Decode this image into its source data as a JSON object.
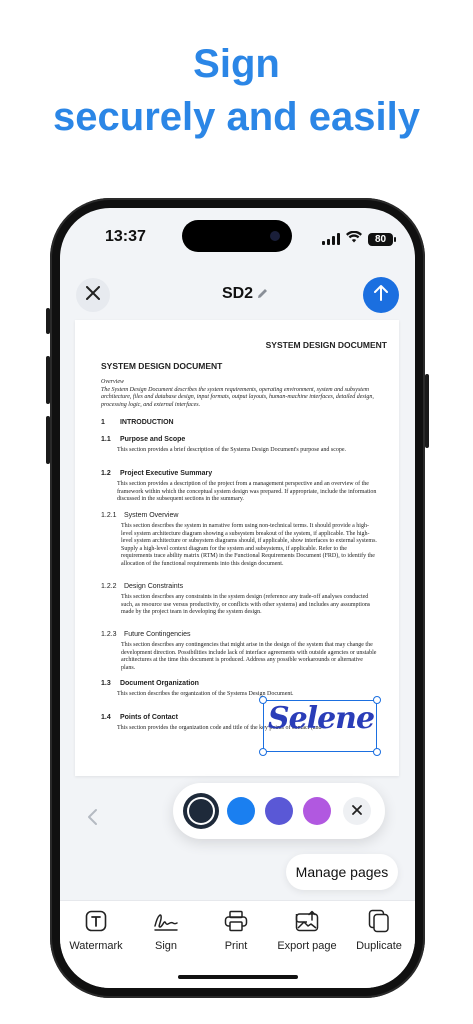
{
  "promo": {
    "line1": "Sign",
    "line2": "securely and easily"
  },
  "status_bar": {
    "time": "13:37",
    "battery": "80"
  },
  "header": {
    "title": "SD2",
    "close_icon": "close-icon",
    "edit_icon": "pencil-icon",
    "upload_icon": "arrow-up-icon"
  },
  "document": {
    "running_header": "SYSTEM DESIGN DOCUMENT",
    "main_title": "SYSTEM DESIGN DOCUMENT",
    "overview_label": "Overview",
    "overview_text": "The System Design Document describes the system requirements, operating environment, system and subsystem architecture, files and database design, input formats, output layouts, human-machine interfaces, detailed design, processing logic, and external interfaces.",
    "sections": [
      {
        "num": "1",
        "title": "INTRODUCTION",
        "text": ""
      },
      {
        "num": "1.1",
        "title": "Purpose and Scope",
        "text": "This section provides a brief description of the Systems Design Document's purpose and scope."
      },
      {
        "num": "1.2",
        "title": "Project Executive Summary",
        "text": "This section provides a description of the project from a management perspective and an overview of the framework within which the conceptual system design was prepared.  If appropriate, include the information discussed in the subsequent sections in the summary."
      },
      {
        "num": "1.2.1",
        "title": "System Overview",
        "text": "This section describes the system in narrative form using non-technical terms. It should provide a high-level system architecture diagram showing a subsystem breakout of the system, if applicable.  The high-level system architecture or subsystem diagrams should, if applicable, show interfaces to external systems.  Supply a high-level context diagram for the system and subsystems, if applicable.  Refer to the requirements trace ability matrix (RTM) in the Functional Requirements Document (FRD), to identify the allocation of the functional requirements into this design document."
      },
      {
        "num": "1.2.2",
        "title": "Design Constraints",
        "text": "This section describes any constraints in the system design (reference any trade-off analyses conducted such, as resource use versus productivity, or conflicts with other systems) and includes any assumptions made by the project team in developing the system design."
      },
      {
        "num": "1.2.3",
        "title": "Future Contingencies",
        "text": "This section describes any contingencies that might arise in the design of the system that may change the development direction.  Possibilities include lack of interface agreements with outside agencies or unstable architectures at the time this document is produced. Address any possible workarounds or alternative plans."
      },
      {
        "num": "1.3",
        "title": "Document Organization",
        "text": "This section describes the organization of the Systems Design Document."
      },
      {
        "num": "1.4",
        "title": "Points of Contact",
        "text": "This section provides the organization code and title of the key points of contact (and"
      }
    ],
    "signature": "Selene"
  },
  "signature_colors": {
    "selected": "#1e2a3a",
    "options": [
      "#1e2a3a",
      "#1a7ff0",
      "#5a58d6",
      "#b158e0"
    ],
    "close_icon": "close-icon"
  },
  "actions": {
    "prev_icon": "chevron-left-icon",
    "manage_pages": "Manage pages"
  },
  "toolbar": {
    "items": [
      {
        "label": "Watermark",
        "icon": "watermark-icon"
      },
      {
        "label": "Sign",
        "icon": "signature-icon"
      },
      {
        "label": "Print",
        "icon": "printer-icon"
      },
      {
        "label": "Export page",
        "icon": "export-image-icon"
      },
      {
        "label": "Duplicate",
        "icon": "duplicate-icon"
      }
    ]
  }
}
